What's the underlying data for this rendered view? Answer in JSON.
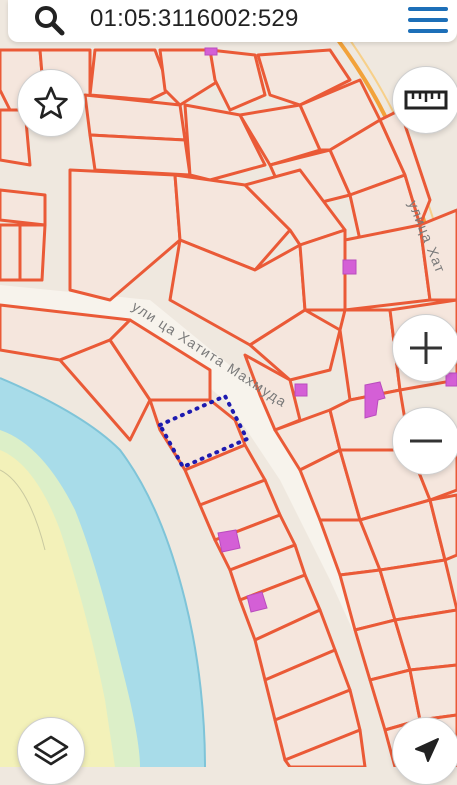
{
  "search": {
    "query": "01:05:3116002:529"
  },
  "map": {
    "street_labels": {
      "khatita": "ули ца Хатита Махмуда",
      "right": "улица Хат"
    },
    "colors": {
      "background": "#efe8df",
      "parcel_fill": "#f5e6dd",
      "parcel_border": "#ea5a37",
      "building": "#d45fd6",
      "water": "#a8dce9",
      "water_edge": "#7fc4d8",
      "park": "#f3f1b9",
      "park_alt": "#dcefc8",
      "road": "#f2eee6",
      "highlight": "#1d1ab0"
    }
  },
  "controls": {
    "favorite": "star-icon",
    "ruler": "ruler-icon",
    "zoom_in": "plus-icon",
    "zoom_out": "minus-icon",
    "layers": "layers-icon",
    "locate": "navigation-arrow-icon"
  }
}
